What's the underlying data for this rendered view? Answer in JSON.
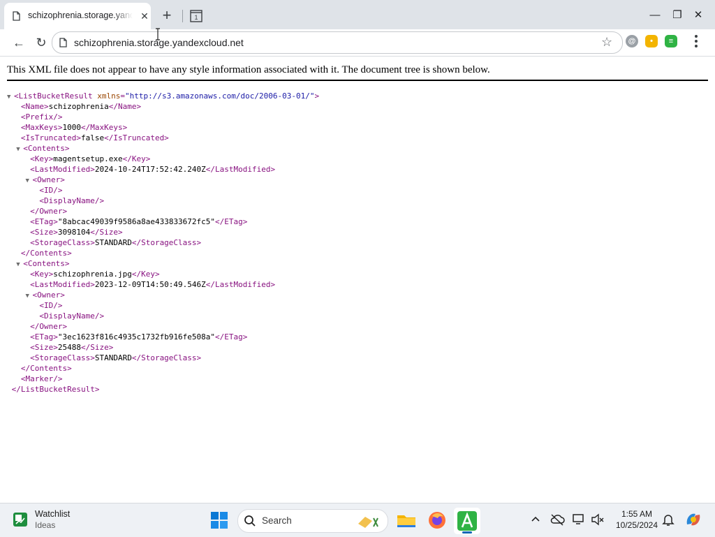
{
  "browser": {
    "tab": {
      "title": "schizophrenia.storage.yandexcloud.net",
      "close_glyph": "✕",
      "icon": "page-icon"
    },
    "newtab_glyph": "+",
    "tab_search_count": "1",
    "window_controls": {
      "minimize": "—",
      "restore": "❐",
      "close": "✕"
    },
    "toolbar": {
      "back_glyph": "←",
      "reload_glyph": "↻",
      "star_glyph": "☆"
    },
    "address": {
      "url": "schizophrenia.storage.yandexcloud.net"
    },
    "extensions": [
      {
        "name": "ext-at-icon",
        "glyph": "@",
        "color": "#9aa0a6"
      },
      {
        "name": "ext-chat-icon",
        "glyph": "•",
        "color": "#f3b400"
      },
      {
        "name": "ext-list-icon",
        "glyph": "≡",
        "color": "#2fb344"
      }
    ]
  },
  "page": {
    "notice": "This XML file does not appear to have any style information associated with it. The document tree is shown below.",
    "colors": {
      "tag": "#881280",
      "attr_name": "#994500",
      "attr_value": "#1a1aa6"
    },
    "xml": {
      "root_tag": "ListBucketResult",
      "xmlns_attr": "xmlns",
      "xmlns_value": "\"http://s3.amazonaws.com/doc/2006-03-01/\"",
      "name": "schizophrenia",
      "prefix": "",
      "max_keys": "1000",
      "is_truncated": "false",
      "contents": [
        {
          "key": "magentsetup.exe",
          "last_modified": "2024-10-24T17:52:42.240Z",
          "etag": "\"8abcac49039f9586a8ae433833672fc5\"",
          "size": "3098104",
          "storage_class": "STANDARD"
        },
        {
          "key": "schizophrenia.jpg",
          "last_modified": "2023-12-09T14:50:49.546Z",
          "etag": "\"3ec1623f816c4935c1732fb916fe508a\"",
          "size": "25488",
          "storage_class": "STANDARD"
        }
      ]
    }
  },
  "taskbar": {
    "widget": {
      "title": "Watchlist",
      "subtitle": "Ideas"
    },
    "search_label": "Search",
    "clock": {
      "time": "1:55 AM",
      "date": "10/25/2024"
    }
  }
}
